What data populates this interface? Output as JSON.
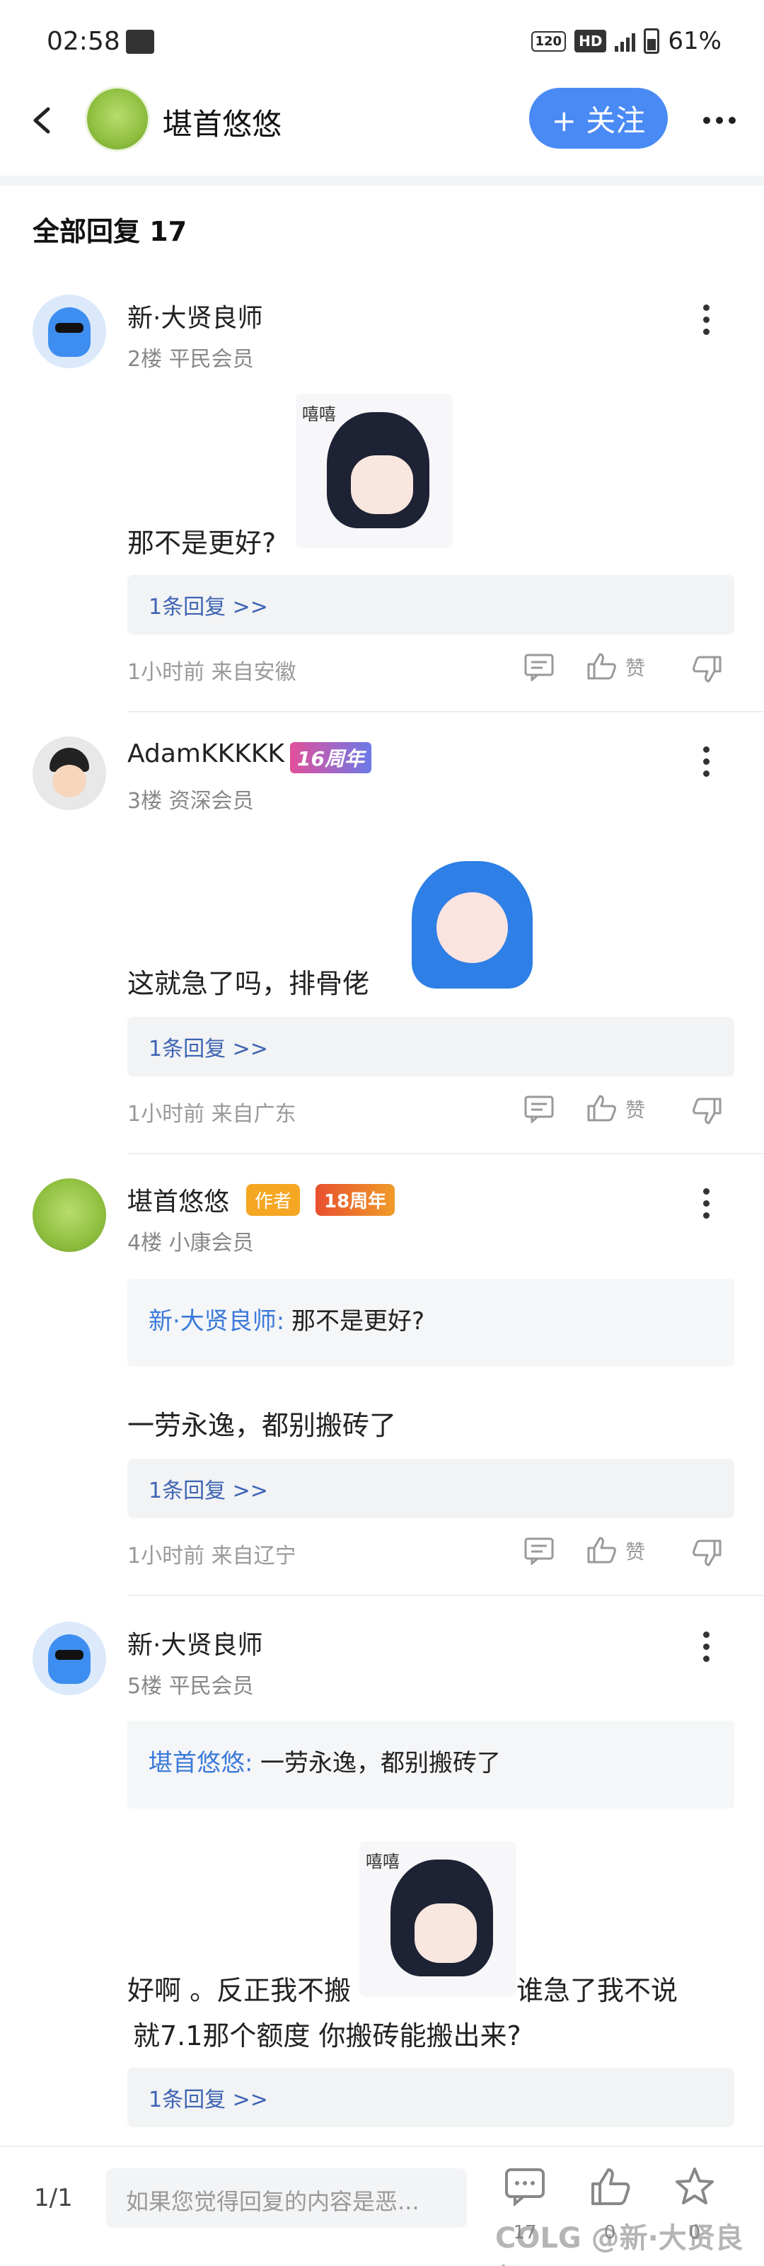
{
  "status_bar": {
    "time": "02:58",
    "net_badge": "120",
    "hd": "HD",
    "signal": "5G",
    "battery": "61%"
  },
  "nav": {
    "title": "堪首悠悠",
    "follow_label": "+ 关注"
  },
  "section": {
    "title": "全部回复  17"
  },
  "posts": [
    {
      "user": "新·大贤良师",
      "floor": "2楼 平民会员",
      "text": "那不是更好?",
      "sticker_caption": "嘻嘻",
      "reply_link": "1条回复 >>",
      "meta": "1小时前 来自安徽",
      "like_label": "赞"
    },
    {
      "user": "AdamKKKKK",
      "badge": "16周年",
      "floor": "3楼 资深会员",
      "text": "这就急了吗，排骨佬",
      "reply_link": "1条回复 >>",
      "meta": "1小时前 来自广东",
      "like_label": "赞"
    },
    {
      "user": "堪首悠悠",
      "author_badge": "作者",
      "badge": "18周年",
      "floor": "4楼 小康会员",
      "quote_user": "新·大贤良师:",
      "quote_text": "那不是更好?",
      "text": "一劳永逸，都别搬砖了",
      "reply_link": "1条回复 >>",
      "meta": "1小时前 来自辽宁",
      "like_label": "赞"
    },
    {
      "user": "新·大贤良师",
      "floor": "5楼 平民会员",
      "quote_user": "堪首悠悠:",
      "quote_text": "一劳永逸，都别搬砖了",
      "text_line1_a": "好啊 。反正我不搬",
      "text_line1_b": "谁急了我不说",
      "text_line2": "就7.1那个额度  你搬砖能搬出来?",
      "sticker_caption": "嘻嘻",
      "reply_link": "1条回复 >>"
    }
  ],
  "bottom_bar": {
    "page": "1/1",
    "input_placeholder": "如果您觉得回复的内容是恶...",
    "comment_count": "17",
    "like_count": "0",
    "fav_count": "0",
    "watermark": "COLG @新·大贤良师"
  },
  "colors": {
    "accent": "#4a8af4",
    "link": "#3d63b3",
    "author": "#f5a623"
  }
}
